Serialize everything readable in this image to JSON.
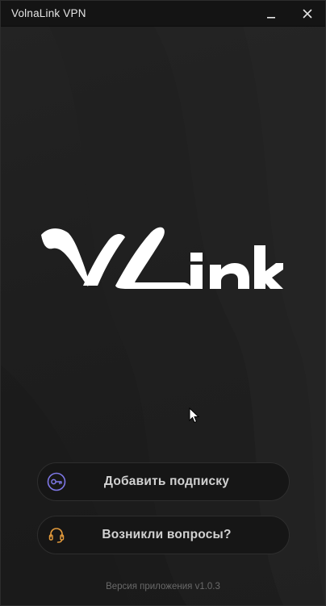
{
  "window": {
    "title": "VolnaLink VPN",
    "minimize_icon": "minimize-icon",
    "close_icon": "close-icon"
  },
  "logo": {
    "wordmark": "VLink",
    "visible_text": "ink",
    "colors": {
      "mark": "#ffffff"
    }
  },
  "actions": {
    "add_subscription": {
      "label": "Добавить подписку",
      "icon": "key-icon",
      "icon_color": "#7f78e8"
    },
    "questions": {
      "label": "Возникли вопросы?",
      "icon": "headset-icon",
      "icon_color": "#e39a3b"
    }
  },
  "footer": {
    "version_text": "Версия приложения v1.0.3"
  },
  "colors": {
    "background": "#1e1e1e",
    "titlebar": "#141414",
    "button_bg": "#161616",
    "button_border": "#2e2e2e",
    "button_text": "#d2d2d2",
    "muted_text": "#6a6a6a"
  }
}
